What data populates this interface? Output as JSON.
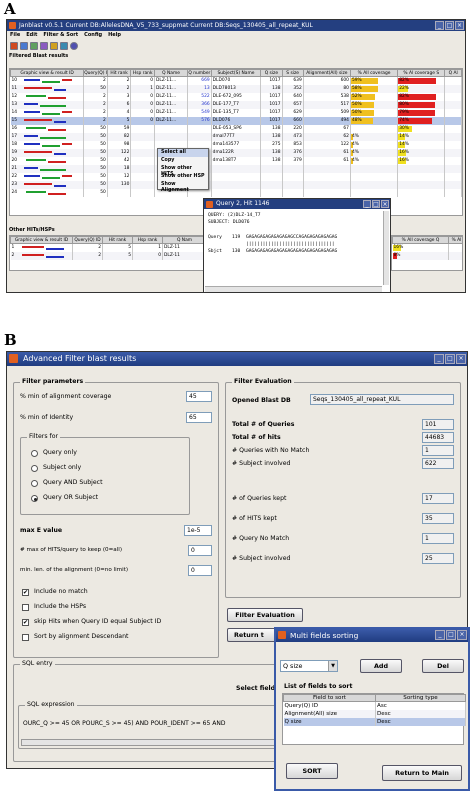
{
  "panel_a": {
    "letter": "A",
    "window_title": "Janblast v0.5.1  Current DB:AllelesDNA_V5_733_suppmat  Current DB:Seqs_130405_all_repeat_KUL",
    "menu": [
      "File",
      "Edit",
      "Filter & Sort",
      "Config",
      "Help"
    ],
    "filtered_label": "Filtered Blast results",
    "columns": [
      "Graphic view & result ID",
      "Query(Q) ID",
      "Hit rank",
      "Hsp rank",
      "Q Name",
      "Q number",
      "Subject(S) Name",
      "Q size",
      "S size",
      "Alignment(All) size",
      "% All coverage",
      "% Al coverage S",
      "Q Al"
    ],
    "rows": [
      {
        "id": "10",
        "qid": "2",
        "hit": "2",
        "hsp": "0",
        "qname": "DLZ-11...",
        "qnum": "669",
        "sname": "DLD070",
        "qsize": "1017",
        "ssize": "639",
        "alsize": "600",
        "cov": "59%",
        "cov_frac": 0.59,
        "covs": "82%",
        "covs_frac": 0.82,
        "covs_color": "#e02020"
      },
      {
        "id": "11",
        "qid": "50",
        "hit": "2",
        "hsp": "1",
        "qname": "DLZ-11...",
        "qnum": "13",
        "sname": "DLD78013",
        "qsize": "138",
        "ssize": "352",
        "alsize": "80",
        "cov": "58%",
        "cov_frac": 0.58,
        "covs": "22%",
        "covs_frac": 0.22,
        "covs_color": "#f0e020"
      },
      {
        "id": "12",
        "qid": "2",
        "hit": "3",
        "hsp": "0",
        "qname": "DLZ-11...",
        "qnum": "522",
        "sname": "DLE-672_095",
        "qsize": "1017",
        "ssize": "640",
        "alsize": "538",
        "cov": "52%",
        "cov_frac": 0.52,
        "covs": "82%",
        "covs_frac": 0.82,
        "covs_color": "#e02020"
      },
      {
        "id": "13",
        "qid": "2",
        "hit": "6",
        "hsp": "0",
        "qname": "DLZ-11...",
        "qnum": "366",
        "sname": "DLE-177_T7",
        "qsize": "1017",
        "ssize": "657",
        "alsize": "517",
        "cov": "50%",
        "cov_frac": 0.5,
        "covs": "80%",
        "covs_frac": 0.8,
        "covs_color": "#e02020"
      },
      {
        "id": "14",
        "qid": "2",
        "hit": "4",
        "hsp": "0",
        "qname": "DLZ-11...",
        "qnum": "549",
        "sname": "DLE-135_T7",
        "qsize": "1017",
        "ssize": "629",
        "alsize": "509",
        "cov": "50%",
        "cov_frac": 0.5,
        "covs": "79%",
        "covs_frac": 0.79,
        "covs_color": "#e02020"
      },
      {
        "id": "15",
        "qid": "2",
        "hit": "5",
        "hsp": "0",
        "qname": "DLZ-11...",
        "qnum": "576",
        "sname": "DLD076",
        "qsize": "1017",
        "ssize": "660",
        "alsize": "494",
        "cov": "48%",
        "cov_frac": 0.48,
        "covs": "74%",
        "covs_frac": 0.74,
        "covs_color": "#e02020"
      },
      {
        "id": "16",
        "qid": "50",
        "hit": "59",
        "hsp": "",
        "qname": "",
        "qnum": "",
        "sname": "DLE-053_SP6",
        "qsize": "138",
        "ssize": "220",
        "alsize": "67",
        "cov": "",
        "cov_frac": 0.0,
        "covs": "30%",
        "covs_frac": 0.3,
        "covs_color": "#f0e020"
      },
      {
        "id": "17",
        "qid": "50",
        "hit": "82",
        "hsp": "",
        "qname": "",
        "qnum": "",
        "sname": "dmal77T7",
        "qsize": "138",
        "ssize": "473",
        "alsize": "62",
        "cov": "4%",
        "cov_frac": 0.04,
        "covs": "14%",
        "covs_frac": 0.14,
        "covs_color": "#f0e020"
      },
      {
        "id": "18",
        "qid": "50",
        "hit": "98",
        "hsp": "",
        "qname": "",
        "qnum": "",
        "sname": "dma143577",
        "qsize": "275",
        "ssize": "853",
        "alsize": "122",
        "cov": "4%",
        "cov_frac": 0.04,
        "covs": "14%",
        "covs_frac": 0.14,
        "covs_color": "#f0e020"
      },
      {
        "id": "19",
        "qid": "50",
        "hit": "122",
        "hsp": "",
        "qname": "",
        "qnum": "",
        "sname": "dma122R",
        "qsize": "138",
        "ssize": "376",
        "alsize": "61",
        "cov": "4%",
        "cov_frac": 0.04,
        "covs": "16%",
        "covs_frac": 0.16,
        "covs_color": "#f0e020"
      },
      {
        "id": "20",
        "qid": "50",
        "hit": "42",
        "hsp": "",
        "qname": "",
        "qnum": "",
        "sname": "dma138T7",
        "qsize": "138",
        "ssize": "379",
        "alsize": "61",
        "cov": "4%",
        "cov_frac": 0.04,
        "covs": "16%",
        "covs_frac": 0.16,
        "covs_color": "#f0e020"
      },
      {
        "id": "21",
        "qid": "50",
        "hit": "18",
        "hsp": "",
        "qname": "",
        "qnum": "",
        "sname": "",
        "qsize": "",
        "ssize": "",
        "alsize": "",
        "cov": "",
        "cov_frac": 0.0,
        "covs": "",
        "covs_frac": 0.0,
        "covs_color": "#f0e020"
      },
      {
        "id": "22",
        "qid": "50",
        "hit": "12",
        "hsp": "",
        "qname": "",
        "qnum": "",
        "sname": "",
        "qsize": "",
        "ssize": "",
        "alsize": "",
        "cov": "",
        "cov_frac": 0.0,
        "covs": "",
        "covs_frac": 0.0,
        "covs_color": "#f0e020"
      },
      {
        "id": "23",
        "qid": "50",
        "hit": "130",
        "hsp": "",
        "qname": "",
        "qnum": "",
        "sname": "",
        "qsize": "",
        "ssize": "",
        "alsize": "",
        "cov": "",
        "cov_frac": 0.0,
        "covs": "",
        "covs_frac": 0.0,
        "covs_color": "#f0e020"
      },
      {
        "id": "24",
        "qid": "50",
        "hit": "",
        "hsp": "",
        "qname": "",
        "qnum": "",
        "sname": "",
        "qsize": "",
        "ssize": "",
        "alsize": "",
        "cov": "",
        "cov_frac": 0.0,
        "covs": "",
        "covs_frac": 0.0,
        "covs_color": "#f0e020"
      }
    ],
    "context_menu": [
      "Select all",
      "Copy",
      "Show other HITS",
      "Show other HSP",
      "Show Alignment"
    ],
    "other_label": "Other HITs/HSPs",
    "other_columns": [
      "Graphic view & result ID",
      "Query(Q) ID",
      "Hit rank",
      "Hsp rank",
      "Q Nam"
    ],
    "other_cols_right": [
      "% All coverage Q",
      "% Al"
    ],
    "other_rows": [
      {
        "id": "1",
        "qid": "2",
        "hit": "5",
        "hsp": "1",
        "qname": "DLZ-11",
        "cov": "16%",
        "cov_frac": 0.16,
        "cov_color": "#f0e020"
      },
      {
        "id": "2",
        "qid": "2",
        "hit": "5",
        "hsp": "0",
        "qname": "DLZ-11",
        "cov": "8%",
        "cov_frac": 0.08,
        "cov_color": "#e02020"
      }
    ],
    "align_popup": {
      "title": "Query 2, Hit 1146",
      "line1": "QUERY: (2)DLZ-14_T7",
      "line2": "SUBJECT: DLD076",
      "query_label": "Query",
      "query_num": "119",
      "query_seq": "GAGAGAGAGAGAGAGAGCCAGAGAGAGAGAGAG",
      "match_seq": "||||||||||||||||||||||||||||||||",
      "sbjct_label": "Sbjct",
      "sbjct_num": "130",
      "sbjct_seq": "GAGAGAGAGAGAGAGAGAGAGAGAGAGAGAGAG"
    }
  },
  "panel_b": {
    "letter": "B",
    "window_title": "Advanced Filter blast results",
    "filter_params": {
      "title": "Filter parameters",
      "min_cov_label": "% min of alignment coverage",
      "min_cov_value": "45",
      "min_id_label": "% min of Identity",
      "min_id_value": "65",
      "filters_for_title": "Filters for",
      "radios": [
        "Query only",
        "Subject only",
        "Query AND Subject",
        "Query OR Subject"
      ],
      "radio_selected": 3,
      "max_e_label": "max E value",
      "max_e_value": "1e-5",
      "max_hits_label": "# max of HITS/query to keep (0=all)",
      "max_hits_value": "0",
      "min_len_label": "min. len. of the alignment (0=no limit)",
      "min_len_value": "0",
      "checks": [
        {
          "label": "Include no match",
          "checked": true
        },
        {
          "label": "Include the HSPs",
          "checked": false
        },
        {
          "label": "skip Hits when Query ID equal Subject ID",
          "checked": true
        },
        {
          "label": "Sort by alignment Descendant",
          "checked": false
        }
      ]
    },
    "filter_eval": {
      "title": "Filter Evaluation",
      "opened_label": "Opened Blast DB",
      "opened_value": "Seqs_130405_all_repeat_KUL",
      "total_queries_label": "Total # of Queries",
      "total_queries_value": "101",
      "total_hits_label": "Total # of hits",
      "total_hits_value": "44683",
      "no_match_label": "# Queries with No Match",
      "no_match_value": "1",
      "subject_label": "# Subject involved",
      "subject_value": "622",
      "kept_queries_label": "# of Queries kept",
      "kept_queries_value": "17",
      "kept_hits_label": "# of HITS kept",
      "kept_hits_value": "35",
      "kept_no_match_label": "# Query No Match",
      "kept_no_match_value": "1",
      "kept_subject_label": "# Subject involved",
      "kept_subject_value": "25"
    },
    "filter_button": "Filter Evaluation",
    "return_button_partial": "Return t",
    "sql": {
      "title": "SQL entry",
      "select_fields_partial": "Select field",
      "expr_title": "SQL expression",
      "expr": "OURC_Q >= 45 OR POURC_S >= 45) AND POUR_IDENT >= 65 AND"
    },
    "sort_dialog": {
      "title": "Multi fields sorting",
      "combo_value": "Q size",
      "add": "Add",
      "del": "Del",
      "list_title": "List of fields to sort",
      "col_field": "Field to sort",
      "col_type": "Sorting type",
      "rows": [
        {
          "field": "Query(Q) ID",
          "type": "Asc"
        },
        {
          "field": "Alignment(All) size",
          "type": "Desc"
        },
        {
          "field": "Q size",
          "type": "Desc"
        }
      ],
      "sort_button": "SORT",
      "return_button": "Return to Main"
    }
  }
}
